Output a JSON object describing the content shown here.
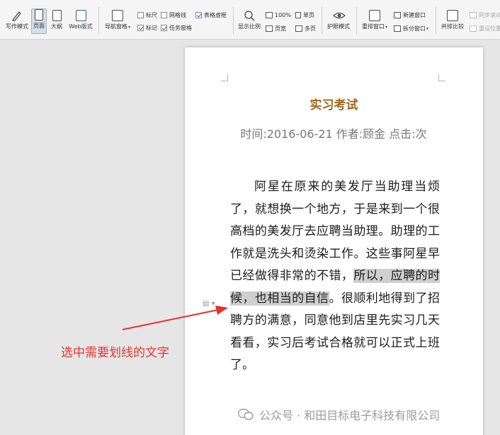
{
  "toolbar": {
    "view_modes": [
      {
        "label": "写作模式"
      },
      {
        "label": "页面"
      },
      {
        "label": "大纲"
      },
      {
        "label": "Web版式"
      }
    ],
    "nav_pane": {
      "label": "导航窗格"
    },
    "show_options": {
      "ruler": "标尺",
      "gridlines": "网格线",
      "table_gridlines": "表格虚框",
      "marks": "标记",
      "task_pane": "任务窗格"
    },
    "zoom": {
      "label": "显示比例",
      "percent": "100%",
      "page_width": "页宽",
      "single_page": "单页",
      "multi_page": "多页"
    },
    "eye_protect": {
      "label": "护眼模式"
    },
    "rearrange": {
      "label": "重排窗口"
    },
    "new_window": {
      "label": "新建窗口"
    },
    "split_window": {
      "label": "拆分窗口"
    },
    "side_by_side": {
      "label": "并排比较"
    },
    "sync_scroll": {
      "label": "同步滚动"
    },
    "reset_position": {
      "label": "重设位置"
    }
  },
  "document": {
    "title": "实习考试",
    "meta": "时间:2016-06-21 作者:顾金 点击:次",
    "body_before": "阿星在原来的美发厅当助理当烦了，就想换一个地方，于是来到一个很高档的美发厅去应聘当助理。助理的工作就是洗头和烫染工作。这些事阿星早已经做得非常的不错，",
    "body_selected": "所以，应聘的时候，也相当的自信",
    "body_after": "。很顺利地得到了招聘方的满意，同意他到店里先实习几天看看，实习后考试合格就可以正式上班了。"
  },
  "annotation": {
    "text": "选中需要划线的文字",
    "color": "#e8322d"
  },
  "watermark": {
    "text": "公众号 · 和田目标电子科技有限公司"
  }
}
